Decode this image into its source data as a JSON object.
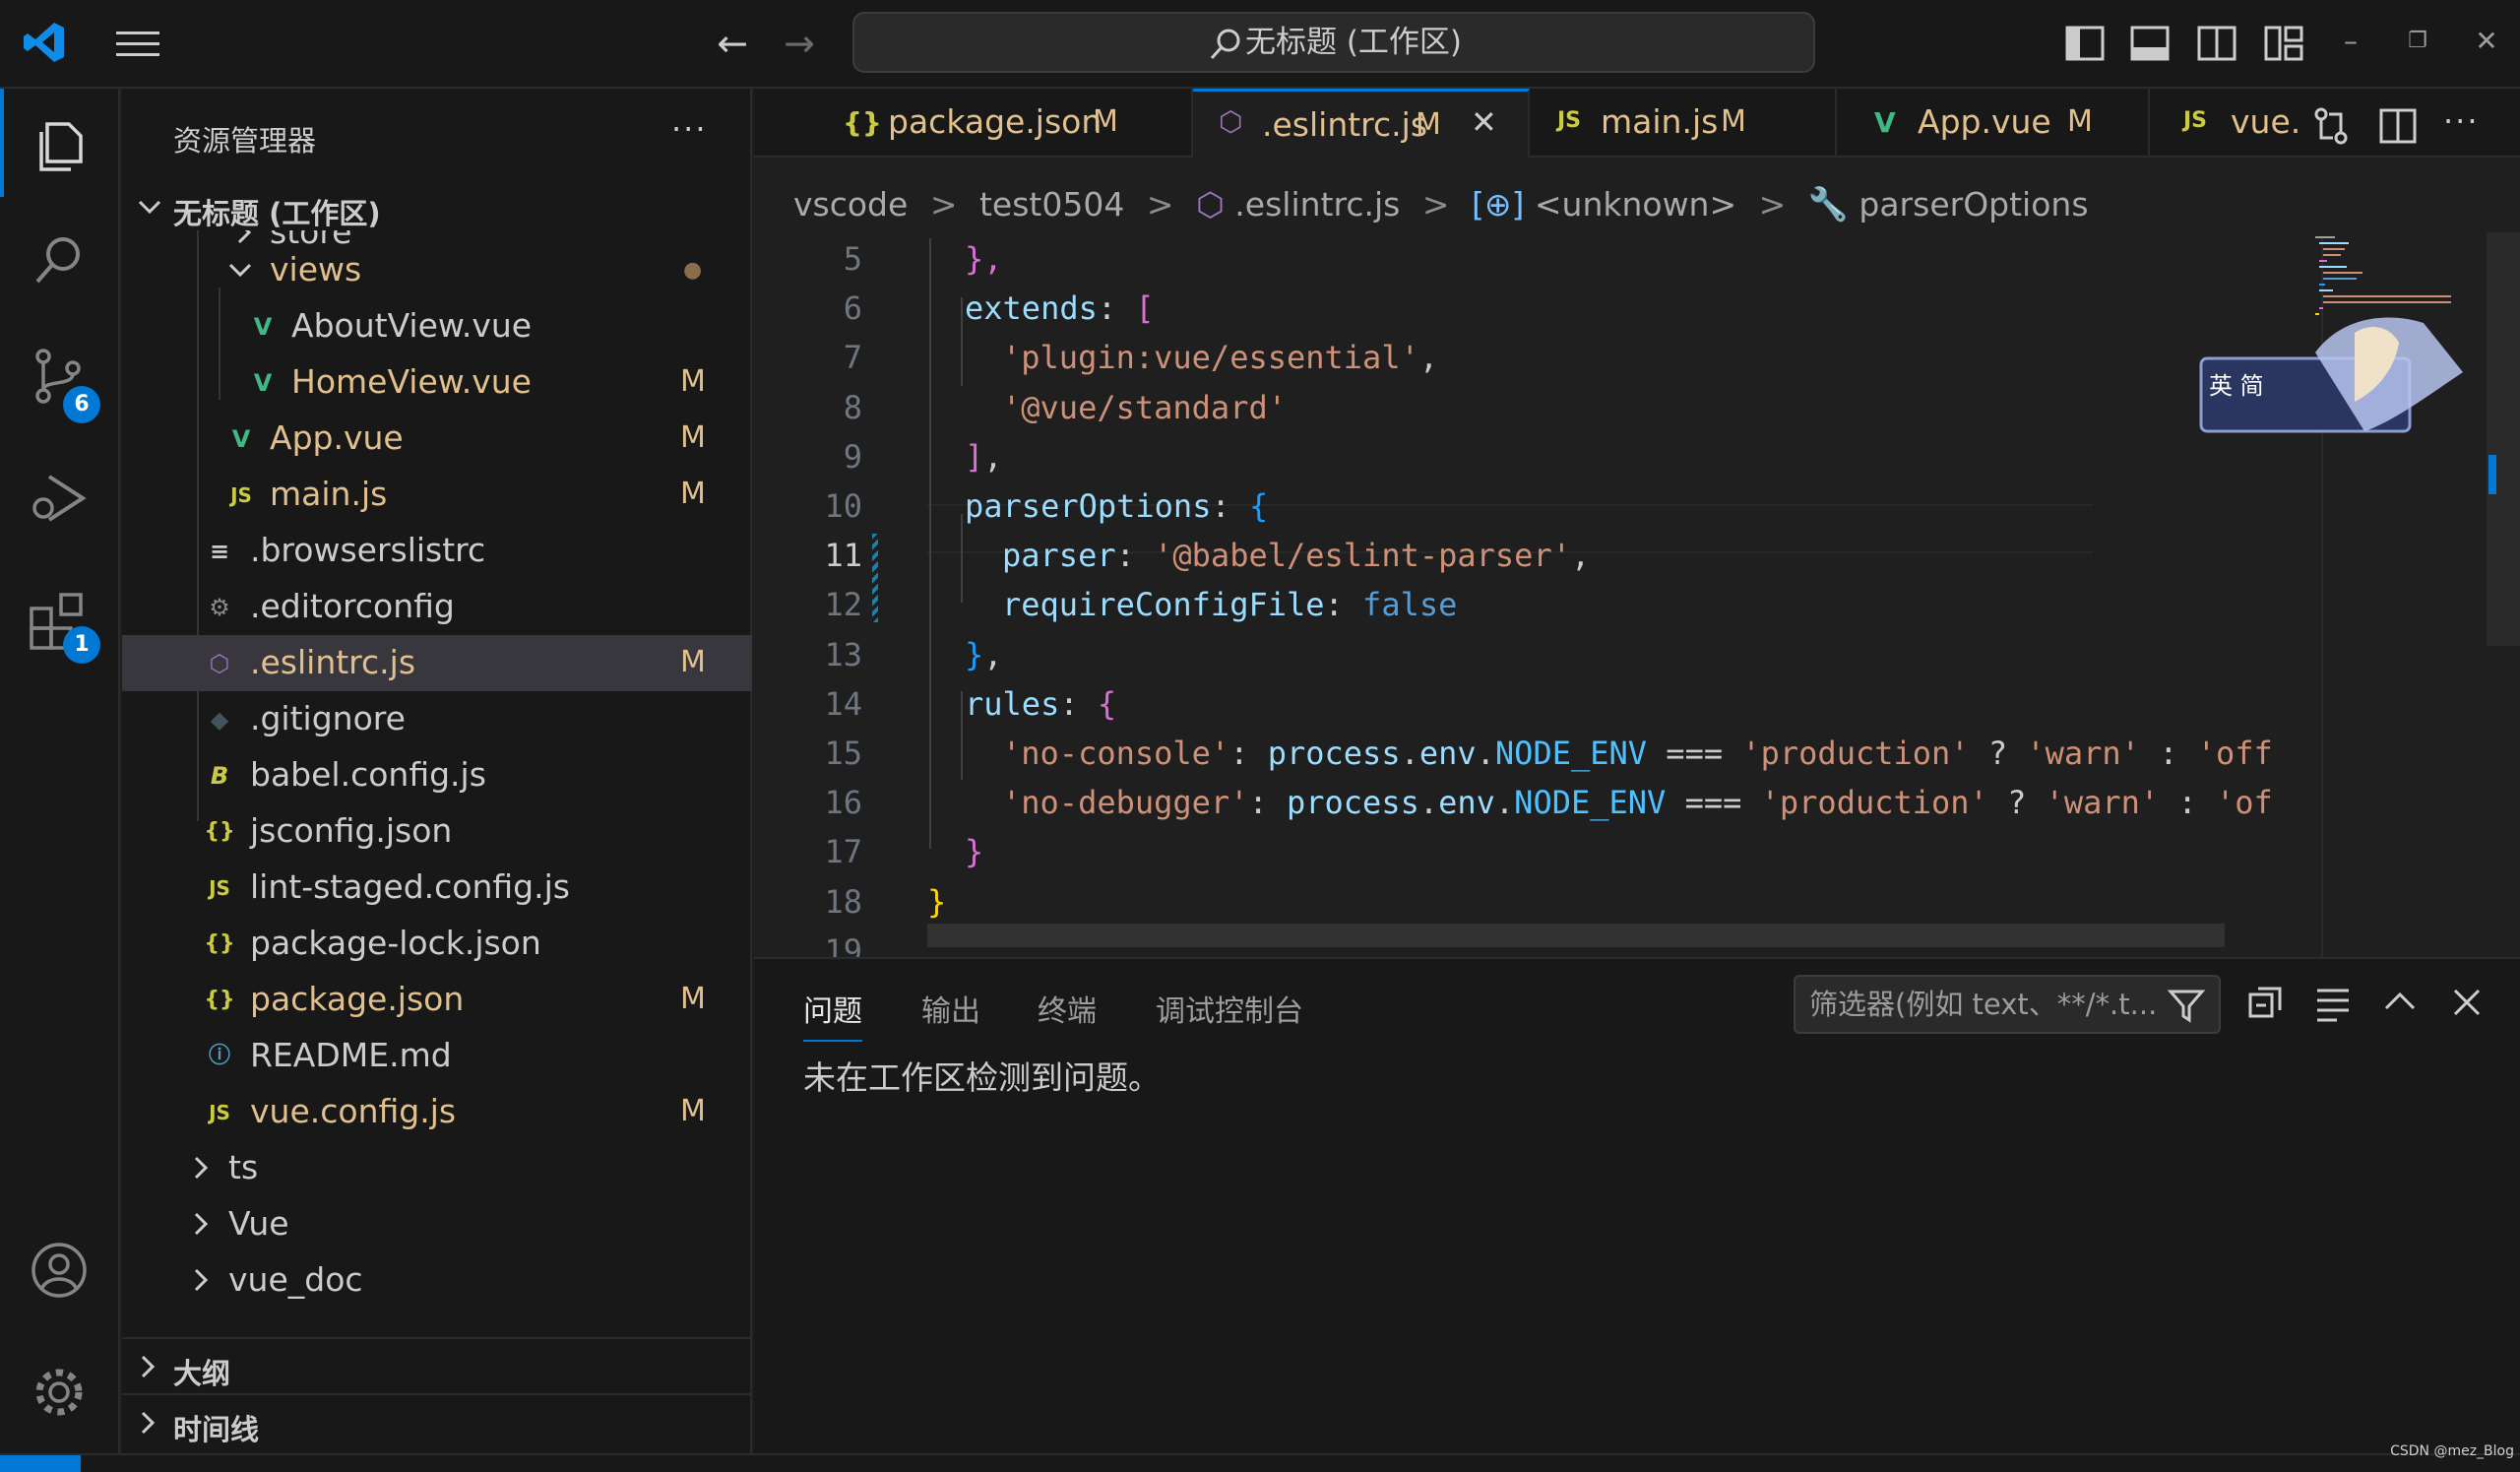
{
  "titlebar": {
    "search_text": "无标题 (工作区)"
  },
  "activity": {
    "source_control_badge": "6",
    "extensions_badge": "1"
  },
  "sidebar": {
    "title": "资源管理器",
    "more": "···",
    "workspace_title": "无标题 (工作区)",
    "items": [
      {
        "label": "store",
        "status": "",
        "kind": "folder"
      },
      {
        "label": "views",
        "status": "●",
        "kind": "folder"
      },
      {
        "label": "AboutView.vue",
        "status": "",
        "kind": "vue"
      },
      {
        "label": "HomeView.vue",
        "status": "M",
        "kind": "vue"
      },
      {
        "label": "App.vue",
        "status": "M",
        "kind": "vue"
      },
      {
        "label": "main.js",
        "status": "M",
        "kind": "js"
      },
      {
        "label": ".browserslistrc",
        "status": "",
        "kind": "text"
      },
      {
        "label": ".editorconfig",
        "status": "",
        "kind": "gear"
      },
      {
        "label": ".eslintrc.js",
        "status": "M",
        "kind": "eslint"
      },
      {
        "label": ".gitignore",
        "status": "",
        "kind": "git"
      },
      {
        "label": "babel.config.js",
        "status": "",
        "kind": "babel"
      },
      {
        "label": "jsconfig.json",
        "status": "",
        "kind": "json"
      },
      {
        "label": "lint-staged.config.js",
        "status": "",
        "kind": "js"
      },
      {
        "label": "package-lock.json",
        "status": "",
        "kind": "json"
      },
      {
        "label": "package.json",
        "status": "M",
        "kind": "json"
      },
      {
        "label": "README.md",
        "status": "",
        "kind": "info"
      },
      {
        "label": "vue.config.js",
        "status": "M",
        "kind": "js"
      },
      {
        "label": "ts",
        "status": "",
        "kind": "folder"
      },
      {
        "label": "Vue",
        "status": "",
        "kind": "folder"
      },
      {
        "label": "vue_doc",
        "status": "",
        "kind": "folder"
      }
    ],
    "outline": "大纲",
    "timeline": "时间线"
  },
  "tabs": [
    {
      "icon": "{}",
      "label": "package.json",
      "status": "M"
    },
    {
      "icon": "eslint",
      "label": ".eslintrc.js",
      "status": "M"
    },
    {
      "icon": "JS",
      "label": "main.js",
      "status": "M"
    },
    {
      "icon": "vue",
      "label": "App.vue",
      "status": "M"
    },
    {
      "icon": "JS",
      "label": "vue.",
      "status": ""
    }
  ],
  "breadcrumb": [
    "vscode",
    "test0504",
    ".eslintrc.js",
    "<unknown>",
    "parserOptions"
  ],
  "editor": {
    "line_numbers": [
      "5",
      "6",
      "7",
      "8",
      "9",
      "10",
      "11",
      "12",
      "13",
      "14",
      "15",
      "16",
      "17",
      "18",
      "19"
    ],
    "current_line": "11",
    "lines": [
      [
        [
          "},",
          "p"
        ]
      ],
      [
        [
          "extends",
          "k"
        ],
        [
          ": ",
          "t"
        ],
        [
          "[",
          "p"
        ]
      ],
      [
        [
          "'plugin:vue/essential'",
          "s"
        ],
        [
          ",",
          "t"
        ]
      ],
      [
        [
          "'@vue/standard'",
          "s"
        ]
      ],
      [
        [
          "]",
          "p"
        ],
        [
          ",",
          "t"
        ]
      ],
      [
        [
          "parserOptions",
          "k"
        ],
        [
          ": ",
          "t"
        ],
        [
          "{",
          "b"
        ]
      ],
      [
        [
          "parser",
          "k"
        ],
        [
          ": ",
          "t"
        ],
        [
          "'@babel/eslint-parser'",
          "s"
        ],
        [
          ",",
          "t"
        ]
      ],
      [
        [
          "requireConfigFile",
          "k"
        ],
        [
          ": ",
          "t"
        ],
        [
          "false",
          "kw"
        ]
      ],
      [
        [
          "}",
          "b"
        ],
        [
          ",",
          "t"
        ]
      ],
      [
        [
          "rules",
          "k"
        ],
        [
          ": ",
          "t"
        ],
        [
          "{",
          "p"
        ]
      ],
      [
        [
          "'no-console'",
          "s"
        ],
        [
          ": ",
          "t"
        ],
        [
          "process",
          "k"
        ],
        [
          ".",
          "t"
        ],
        [
          "env",
          "k"
        ],
        [
          ".",
          "t"
        ],
        [
          "NODE_ENV",
          "var"
        ],
        [
          " === ",
          "t"
        ],
        [
          "'production'",
          "s"
        ],
        [
          " ? ",
          "t"
        ],
        [
          "'warn'",
          "s"
        ],
        [
          " : ",
          "t"
        ],
        [
          "'off",
          "s"
        ]
      ],
      [
        [
          "'no-debugger'",
          "s"
        ],
        [
          ": ",
          "t"
        ],
        [
          "process",
          "k"
        ],
        [
          ".",
          "t"
        ],
        [
          "env",
          "k"
        ],
        [
          ".",
          "t"
        ],
        [
          "NODE_ENV",
          "var"
        ],
        [
          " === ",
          "t"
        ],
        [
          "'production'",
          "s"
        ],
        [
          " ? ",
          "t"
        ],
        [
          "'warn'",
          "s"
        ],
        [
          " : ",
          "t"
        ],
        [
          "'of",
          "s"
        ]
      ],
      [
        [
          "}",
          "p"
        ]
      ],
      [
        [
          "}",
          "y"
        ]
      ],
      []
    ],
    "sticker_text": "英 简"
  },
  "panel": {
    "tabs": [
      "问题",
      "输出",
      "终端",
      "调试控制台"
    ],
    "filter_placeholder": "筛选器(例如 text、**/*.t...",
    "message": "未在工作区检测到问题。"
  },
  "watermark": "CSDN @mez_Blog",
  "colors": {
    "accent": "#0078d4",
    "modified": "#e2c08d",
    "vue": "#41b883",
    "js": "#cbcb41"
  }
}
